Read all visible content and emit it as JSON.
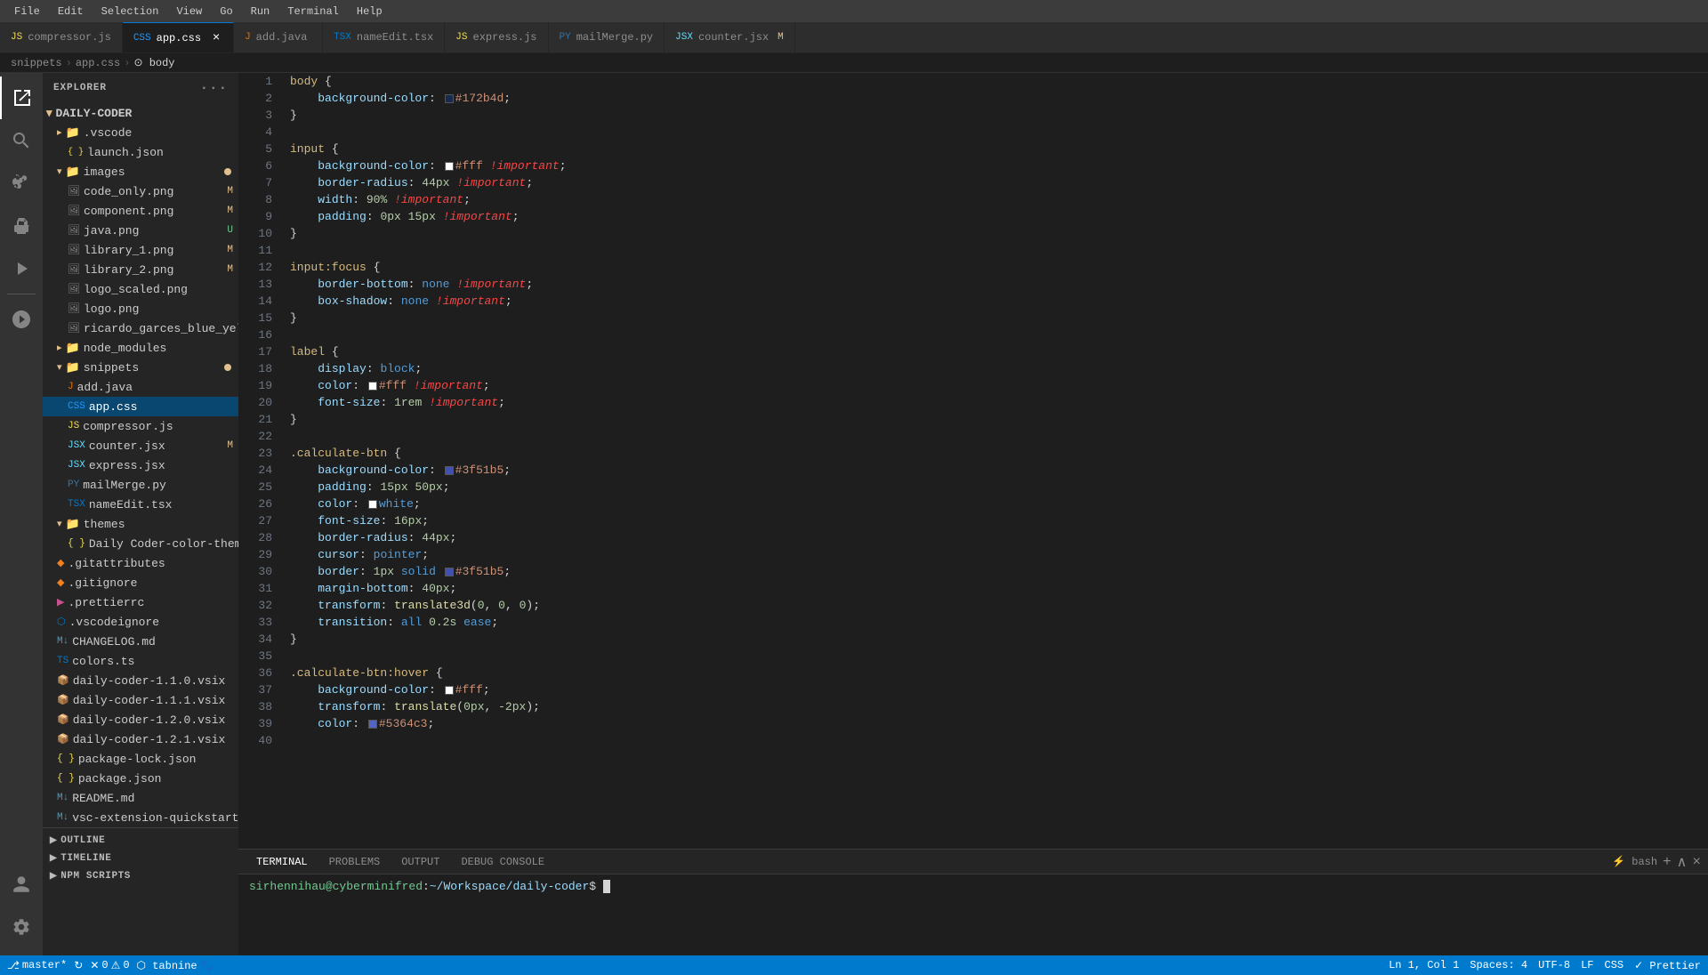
{
  "menubar": {
    "items": [
      "File",
      "Edit",
      "Selection",
      "View",
      "Go",
      "Run",
      "Terminal",
      "Help"
    ]
  },
  "tabbar": {
    "tabs": [
      {
        "id": "compressor",
        "label": "compressor.js",
        "icon": "js",
        "active": false,
        "modified": false
      },
      {
        "id": "appcss",
        "label": "app.css",
        "icon": "css",
        "active": true,
        "modified": false,
        "closable": true
      },
      {
        "id": "addjava",
        "label": "add.java",
        "icon": "java",
        "active": false,
        "modified": false
      },
      {
        "id": "nameedit",
        "label": "nameEdit.tsx",
        "icon": "tsx",
        "active": false,
        "modified": false
      },
      {
        "id": "express",
        "label": "express.js",
        "icon": "js",
        "active": false,
        "modified": false
      },
      {
        "id": "mailmerge",
        "label": "mailMerge.py",
        "icon": "py",
        "active": false,
        "modified": false
      },
      {
        "id": "counter",
        "label": "counter.jsx",
        "icon": "jsx",
        "active": false,
        "modified": true
      }
    ]
  },
  "breadcrumb": {
    "parts": [
      "snippets",
      "app.css",
      "body"
    ]
  },
  "sidebar": {
    "title": "Explorer",
    "root": "DAILY-CODER",
    "tree": [
      {
        "label": ".vscode",
        "type": "folder",
        "depth": 1,
        "expanded": true
      },
      {
        "label": "launch.json",
        "type": "file",
        "depth": 2
      },
      {
        "label": "images",
        "type": "folder",
        "depth": 1,
        "expanded": true,
        "badge": "M"
      },
      {
        "label": "code_only.png",
        "type": "image",
        "depth": 2,
        "badge": "M"
      },
      {
        "label": "component.png",
        "type": "image",
        "depth": 2,
        "badge": "M"
      },
      {
        "label": "java.png",
        "type": "image",
        "depth": 2,
        "badge": "U"
      },
      {
        "label": "library_1.png",
        "type": "image",
        "depth": 2,
        "badge": "M"
      },
      {
        "label": "library_2.png",
        "type": "image",
        "depth": 2,
        "badge": "M"
      },
      {
        "label": "logo_scaled.png",
        "type": "image",
        "depth": 2
      },
      {
        "label": "logo.png",
        "type": "image",
        "depth": 2
      },
      {
        "label": "ricardo_garces_blue_yellow_w...",
        "type": "image",
        "depth": 2
      },
      {
        "label": "node_modules",
        "type": "folder",
        "depth": 1,
        "expanded": false
      },
      {
        "label": "snippets",
        "type": "folder",
        "depth": 1,
        "expanded": true,
        "badge": "M"
      },
      {
        "label": "add.java",
        "type": "java",
        "depth": 2
      },
      {
        "label": "app.css",
        "type": "css",
        "depth": 2,
        "selected": true
      },
      {
        "label": "compressor.js",
        "type": "js",
        "depth": 2
      },
      {
        "label": "counter.jsx",
        "type": "jsx",
        "depth": 2,
        "badge": "M"
      },
      {
        "label": "express.jsx",
        "type": "jsx",
        "depth": 2
      },
      {
        "label": "mailMerge.py",
        "type": "py",
        "depth": 2
      },
      {
        "label": "nameEdit.tsx",
        "type": "tsx",
        "depth": 2
      },
      {
        "label": "themes",
        "type": "folder",
        "depth": 1,
        "expanded": true
      },
      {
        "label": "Daily Coder-color-theme.json",
        "type": "json",
        "depth": 2
      },
      {
        "label": ".gitattributes",
        "type": "git",
        "depth": 1
      },
      {
        "label": ".gitignore",
        "type": "git",
        "depth": 1
      },
      {
        "label": ".prettierrc",
        "type": "prettier",
        "depth": 1
      },
      {
        "label": ".vscodeignore",
        "type": "vscode",
        "depth": 1
      },
      {
        "label": "CHANGELOG.md",
        "type": "md",
        "depth": 1
      },
      {
        "label": "colors.ts",
        "type": "ts",
        "depth": 1
      },
      {
        "label": "daily-coder-1.1.0.vsix",
        "type": "vsix",
        "depth": 1
      },
      {
        "label": "daily-coder-1.1.1.vsix",
        "type": "vsix",
        "depth": 1
      },
      {
        "label": "daily-coder-1.2.0.vsix",
        "type": "vsix",
        "depth": 1
      },
      {
        "label": "daily-coder-1.2.1.vsix",
        "type": "vsix",
        "depth": 1
      },
      {
        "label": "package-lock.json",
        "type": "json",
        "depth": 1
      },
      {
        "label": "package.json",
        "type": "json",
        "depth": 1
      },
      {
        "label": "README.md",
        "type": "md",
        "depth": 1
      },
      {
        "label": "vsc-extension-quickstart.md",
        "type": "md",
        "depth": 1
      }
    ]
  },
  "sidebar_bottom": {
    "sections": [
      "OUTLINE",
      "TIMELINE",
      "NPM SCRIPTS"
    ]
  },
  "editor": {
    "lines": [
      {
        "num": "",
        "code": "body {"
      },
      {
        "num": "",
        "code": "    background-color: ■#172b4d;"
      },
      {
        "num": "",
        "code": "}"
      },
      {
        "num": "",
        "code": ""
      },
      {
        "num": "",
        "code": "input {"
      },
      {
        "num": "",
        "code": "    background-color: ■#fff !important;"
      },
      {
        "num": "",
        "code": "    border-radius: 44px !important;"
      },
      {
        "num": "",
        "code": "    width: 90% !important;"
      },
      {
        "num": "",
        "code": "    padding: 0px 15px !important;"
      },
      {
        "num": "",
        "code": "}"
      },
      {
        "num": "",
        "code": ""
      },
      {
        "num": "",
        "code": "input:focus {"
      },
      {
        "num": "",
        "code": "    border-bottom: none !important;"
      },
      {
        "num": "",
        "code": "    box-shadow: none !important;"
      },
      {
        "num": "",
        "code": "}"
      },
      {
        "num": "",
        "code": ""
      },
      {
        "num": "",
        "code": "label {"
      },
      {
        "num": "",
        "code": "    display: block;"
      },
      {
        "num": "",
        "code": "    color: ■#fff !important;"
      },
      {
        "num": "",
        "code": "    font-size: 1rem !important;"
      },
      {
        "num": "",
        "code": "}"
      },
      {
        "num": "",
        "code": ""
      },
      {
        "num": "",
        "code": ".calculate-btn {"
      },
      {
        "num": "",
        "code": "    background-color: ■#3f51b5;"
      },
      {
        "num": "",
        "code": "    padding: 15px 50px;"
      },
      {
        "num": "",
        "code": "    color: ■white;"
      },
      {
        "num": "",
        "code": "    font-size: 16px;"
      },
      {
        "num": "",
        "code": "    border-radius: 44px;"
      },
      {
        "num": "",
        "code": "    cursor: pointer;"
      },
      {
        "num": "",
        "code": "    border: 1px solid ■#3f51b5;"
      },
      {
        "num": "",
        "code": "    margin-bottom: 40px;"
      },
      {
        "num": "",
        "code": "    transform: translate3d(0, 0, 0);"
      },
      {
        "num": "",
        "code": "    transition: all 0.2s ease;"
      },
      {
        "num": "",
        "code": "}"
      },
      {
        "num": "",
        "code": ""
      },
      {
        "num": "",
        "code": ".calculate-btn:hover {"
      },
      {
        "num": "",
        "code": "    background-color: ■#fff;"
      },
      {
        "num": "",
        "code": "    transform: translate(0px, -2px);"
      },
      {
        "num": "",
        "code": "    color: ■#5364c3;"
      }
    ]
  },
  "terminal": {
    "tabs": [
      "TERMINAL",
      "PROBLEMS",
      "OUTPUT",
      "DEBUG CONSOLE"
    ],
    "active_tab": "TERMINAL",
    "prompt": "sirhennihau@cyberminifred:~/Workspace/daily-coder$",
    "bash_label": "bash"
  },
  "statusbar": {
    "branch": "master",
    "sync_icon": "↻",
    "errors": "0",
    "warnings": "0",
    "line_col": "Ln 1, Col 1",
    "spaces": "Spaces: 4",
    "encoding": "UTF-8",
    "line_ending": "LF",
    "language": "CSS",
    "prettier": "Prettier",
    "tabnine": "tabnine"
  },
  "icons": {
    "explorer": "❐",
    "search": "🔍",
    "git": "⑂",
    "extensions": "⬜",
    "run": "▶",
    "account": "👤",
    "settings": "⚙"
  }
}
